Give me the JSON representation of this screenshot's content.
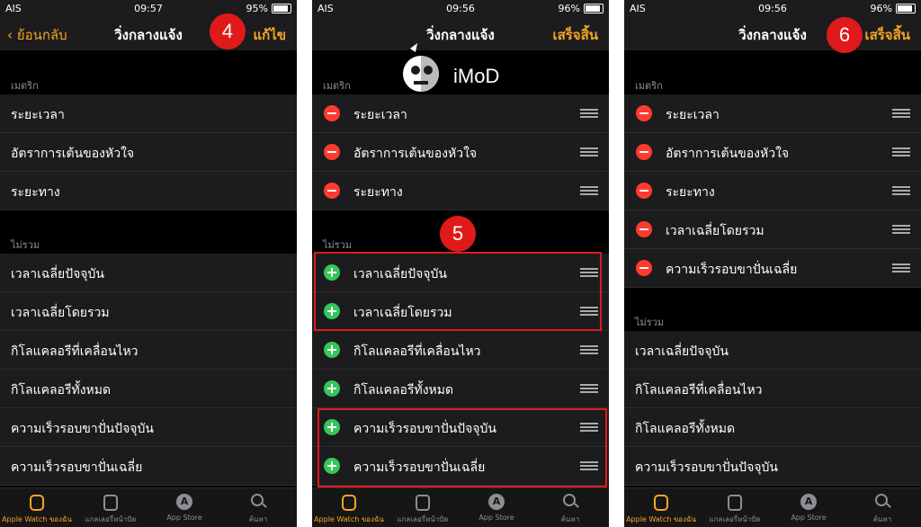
{
  "status": {
    "carrier": "AIS",
    "p1": {
      "time": "09:57",
      "battery": "95%"
    },
    "p2": {
      "time": "09:56",
      "battery": "96%"
    },
    "p3": {
      "time": "09:56",
      "battery": "96%"
    }
  },
  "nav": {
    "title": "วิ่งกลางแจ้ง",
    "back": "ย้อนกลับ",
    "edit": "แก้ไข",
    "done": "เสร็จสิ้น"
  },
  "sections": {
    "metrics": "เมตริก",
    "excluded": "ไม่รวม"
  },
  "p1": {
    "metrics": [
      "ระยะเวลา",
      "อัตราการเต้นของหัวใจ",
      "ระยะทาง"
    ],
    "excluded": [
      "เวลาเฉลี่ยปัจจุบัน",
      "เวลาเฉลี่ยโดยรวม",
      "กิโลแคลอรีที่เคลื่อนไหว",
      "กิโลแคลอรีทั้งหมด",
      "ความเร็วรอบขาปั่นปัจจุบัน",
      "ความเร็วรอบขาปั่นเฉลี่ย"
    ]
  },
  "p2": {
    "metrics": [
      "ระยะเวลา",
      "อัตราการเต้นของหัวใจ",
      "ระยะทาง"
    ],
    "excluded": [
      "เวลาเฉลี่ยปัจจุบัน",
      "เวลาเฉลี่ยโดยรวม",
      "กิโลแคลอรีที่เคลื่อนไหว",
      "กิโลแคลอรีทั้งหมด",
      "ความเร็วรอบขาปั่นปัจจุบัน",
      "ความเร็วรอบขาปั่นเฉลี่ย"
    ]
  },
  "p3": {
    "metrics": [
      "ระยะเวลา",
      "อัตราการเต้นของหัวใจ",
      "ระยะทาง",
      "เวลาเฉลี่ยโดยรวม",
      "ความเร็วรอบขาปั่นเฉลี่ย"
    ],
    "excluded": [
      "เวลาเฉลี่ยปัจจุบัน",
      "กิโลแคลอรีที่เคลื่อนไหว",
      "กิโลแคลอรีทั้งหมด",
      "ความเร็วรอบขาปั่นปัจจุบัน"
    ]
  },
  "tabs": [
    "Apple Watch ของฉัน",
    "แกลเลอรี่หน้าปัด",
    "App Store",
    "ค้นหา"
  ],
  "badges": {
    "step4": "4",
    "step5": "5",
    "step6": "6"
  },
  "logo": "iMoD",
  "colors": {
    "accent": "#f5a623",
    "delete": "#ff3b30",
    "add": "#34c759",
    "annotation": "#e01a1a"
  }
}
